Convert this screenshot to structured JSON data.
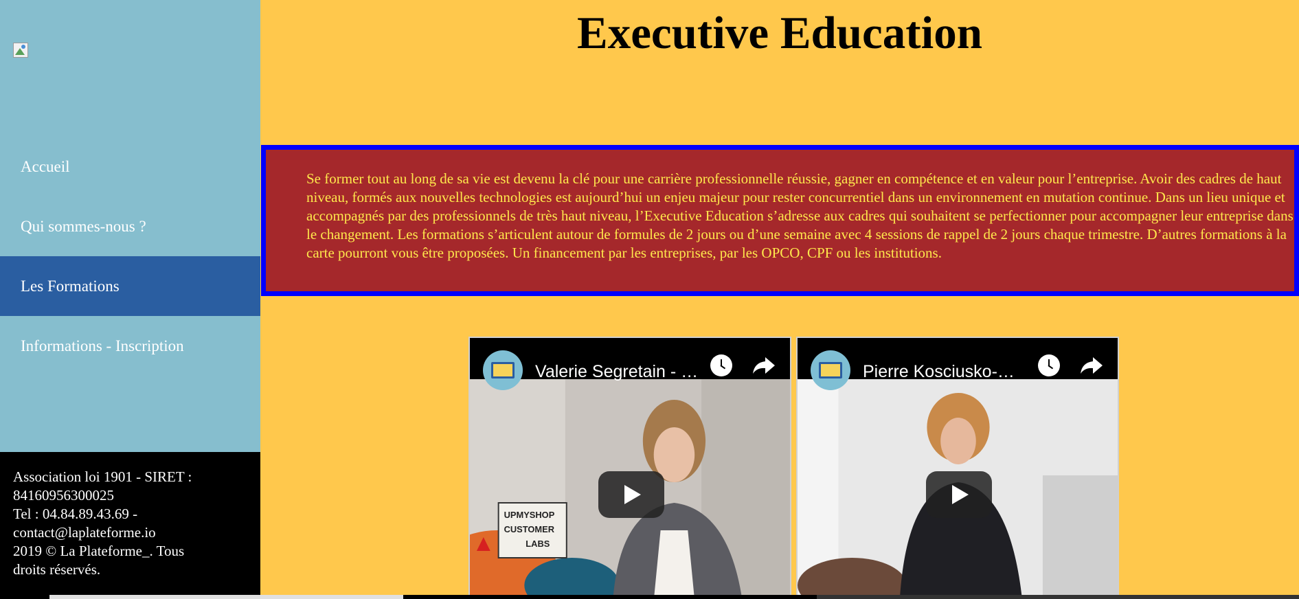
{
  "page": {
    "title": "Executive Education",
    "intro": "Se former tout au long de sa vie est devenu la clé pour une carrière professionnelle réussie, gagner en compétence et en valeur pour l’entreprise. Avoir des cadres de haut niveau, formés aux nouvelles technologies est aujourd’hui un enjeu majeur pour rester concurrentiel dans un environnement en mutation continue. Dans un lieu unique et accompagnés par des professionnels de très haut niveau, l’Executive Education s’adresse aux cadres qui souhaitent se perfectionner pour accompagner leur entreprise dans le changement. Les formations s’articulent autour de formules de 2 jours ou d’une semaine avec 4 sessions de rappel de 2 jours chaque trimestre. D’autres formations à la carte pourront vous être proposées. Un financement par les entreprises, par les OPCO, CPF ou les institutions."
  },
  "nav": {
    "items": [
      {
        "label": "Accueil",
        "active": false
      },
      {
        "label": "Qui sommes-nous ?",
        "active": false
      },
      {
        "label": "Les Formations",
        "active": true
      },
      {
        "label": "Informations - Inscription",
        "active": false
      }
    ]
  },
  "footer": {
    "line1": "Association loi 1901 - SIRET :",
    "line2": "84160956300025",
    "line3": "Tel : 04.84.89.43.69 -",
    "line4": "contact@laplateforme.io",
    "line5": "2019 © La Plateforme_. Tous",
    "line6": "droits réservés."
  },
  "videos": [
    {
      "title": "Valerie Segretain - …",
      "icons": [
        "channel-avatar",
        "clock-icon",
        "share-icon",
        "play-icon"
      ]
    },
    {
      "title": "Pierre Kosciusko-…",
      "icons": [
        "channel-avatar",
        "clock-icon",
        "share-icon",
        "play-icon"
      ]
    }
  ],
  "lightbox_text": {
    "line1": "UPMYSHOP",
    "line2": "CUSTOMER",
    "line3": "LABS"
  },
  "colors": {
    "page_bg": "#ffc84c",
    "sidebar_bg": "#86bece",
    "nav_active_bg": "#2a5ea1",
    "intro_bg": "#a5282b",
    "intro_border": "#0000ff",
    "intro_text": "#ffe84c",
    "footer_bg": "#000000"
  }
}
